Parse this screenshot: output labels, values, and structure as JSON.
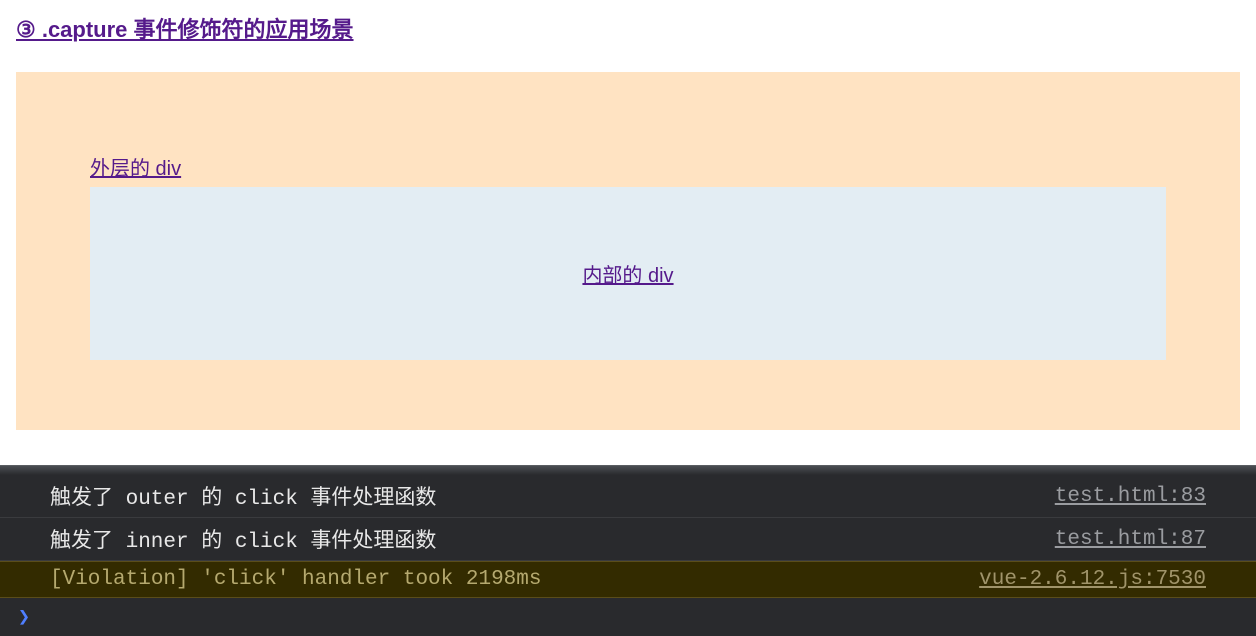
{
  "heading": "③ .capture 事件修饰符的应用场景",
  "outer_div_label": "外层的 div",
  "inner_div_label": "内部的 div",
  "console": {
    "rows": [
      {
        "message": "触发了 outer 的 click 事件处理函数",
        "source": "test.html:83",
        "type": "log"
      },
      {
        "message": "触发了 inner 的 click 事件处理函数",
        "source": "test.html:87",
        "type": "log"
      },
      {
        "message": "[Violation] 'click' handler took 2198ms",
        "source": "vue-2.6.12.js:7530",
        "type": "violation"
      }
    ]
  }
}
